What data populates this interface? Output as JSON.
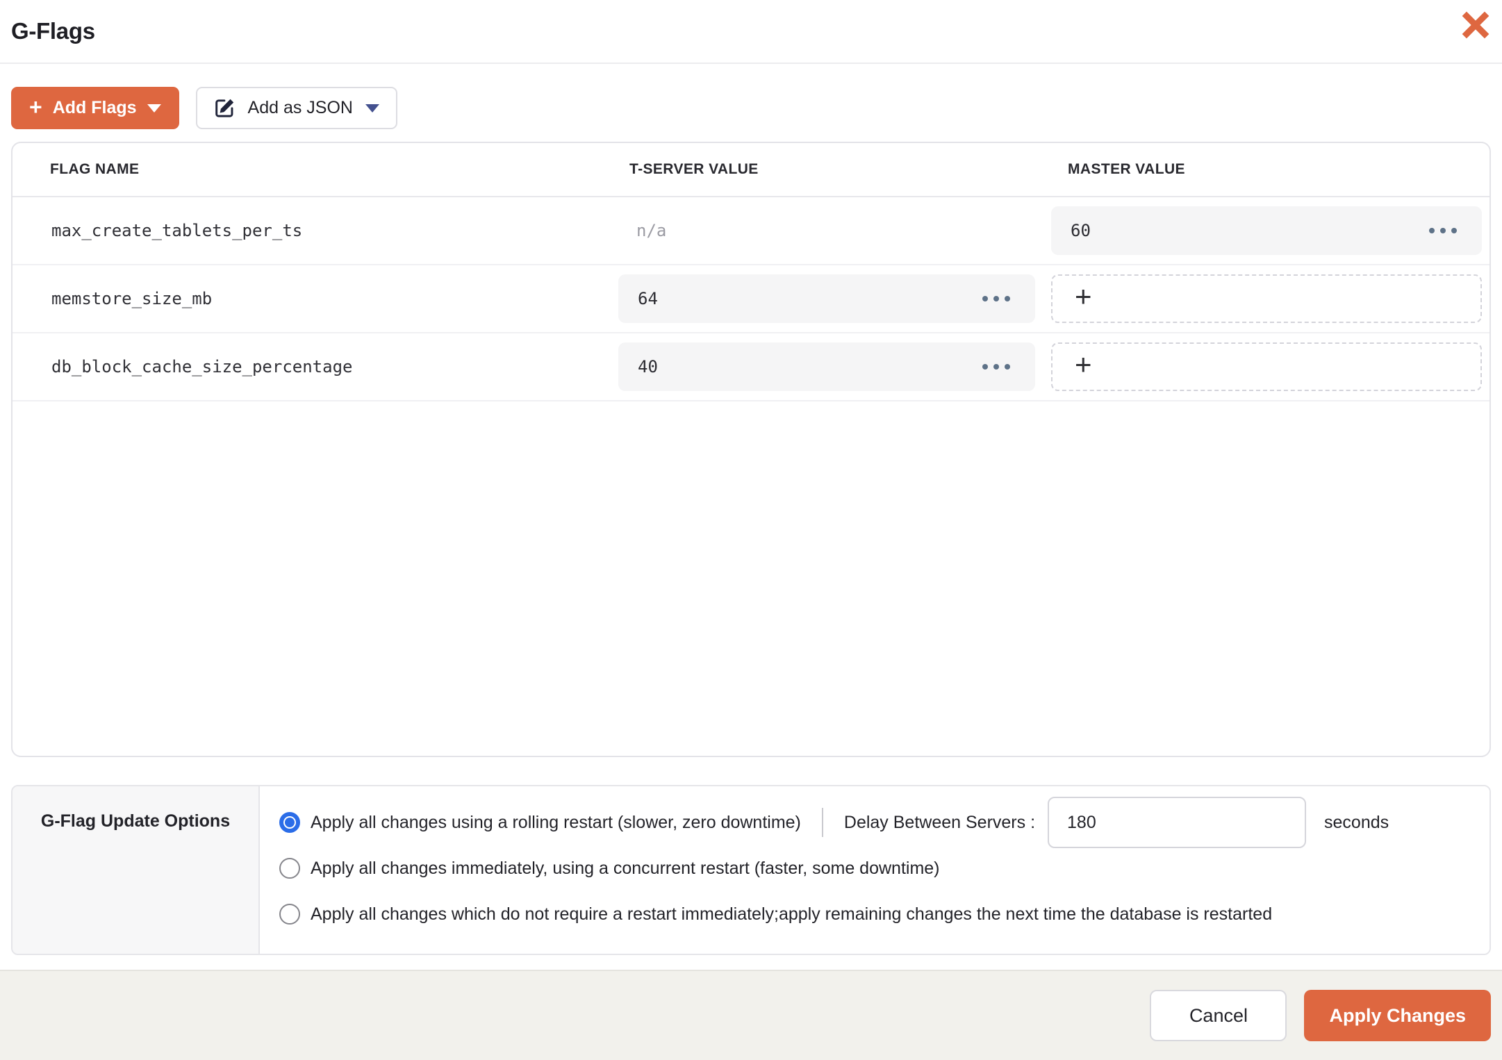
{
  "modal": {
    "title": "G-Flags"
  },
  "icons": {
    "plus": "+"
  },
  "toolbar": {
    "add_flags_label": "Add Flags",
    "add_as_json_label": "Add as JSON"
  },
  "table": {
    "columns": [
      "FLAG NAME",
      "T-SERVER VALUE",
      "MASTER VALUE"
    ],
    "rows": [
      {
        "flag": "max_create_tablets_per_ts",
        "tserver": "n/a",
        "master": "60"
      },
      {
        "flag": "memstore_size_mb",
        "tserver": "64",
        "master": ""
      },
      {
        "flag": "db_block_cache_size_percentage",
        "tserver": "40",
        "master": ""
      }
    ]
  },
  "update_options": {
    "section_label": "G-Flag Update Options",
    "options": [
      {
        "label": "Apply all changes using a rolling restart (slower, zero downtime)",
        "selected": true
      },
      {
        "label": "Apply all changes immediately, using a concurrent restart (faster, some downtime)",
        "selected": false
      },
      {
        "label": "Apply all changes which do not require a restart immediately;apply remaining changes the next time the database is restarted",
        "selected": false
      }
    ],
    "delay_label": "Delay Between Servers :",
    "delay_value": "180",
    "delay_unit": "seconds"
  },
  "footer": {
    "cancel_label": "Cancel",
    "apply_label": "Apply Changes"
  },
  "colors": {
    "accent_orange": "#DE6740",
    "radio_blue": "#2B6DE8",
    "json_caret_navy": "#44518F",
    "pill_bg": "#F5F5F6",
    "footer_bg": "#F2F1EC"
  }
}
